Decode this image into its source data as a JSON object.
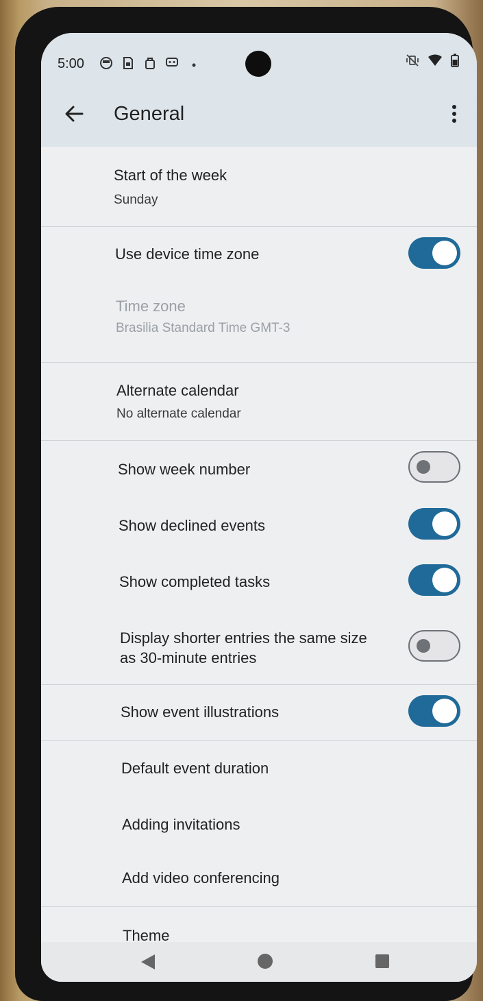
{
  "status_bar": {
    "time": "5:00",
    "left_icons": [
      "notification-icon",
      "sim-icon",
      "bag-icon",
      "message-icon"
    ],
    "dot": "•"
  },
  "app_bar": {
    "title": "General"
  },
  "settings": {
    "start_of_week": {
      "title": "Start of the week",
      "value": "Sunday"
    },
    "use_device_time_zone": {
      "title": "Use device time zone",
      "enabled": true
    },
    "time_zone": {
      "title": "Time zone",
      "value": "Brasilia Standard Time  GMT-3"
    },
    "alternate_calendar": {
      "title": "Alternate calendar",
      "value": "No alternate calendar"
    },
    "show_week_number": {
      "title": "Show week number",
      "enabled": false
    },
    "show_declined_events": {
      "title": "Show declined events",
      "enabled": true
    },
    "show_completed_tasks": {
      "title": "Show completed tasks",
      "enabled": true
    },
    "display_shorter_entries": {
      "title_line1": "Display shorter entries the same size",
      "title_line2": "as 30-minute entries",
      "enabled": false
    },
    "show_event_illustrations": {
      "title": "Show event illustrations",
      "enabled": true
    },
    "default_event_duration": {
      "title": "Default event duration"
    },
    "adding_invitations": {
      "title": "Adding invitations"
    },
    "add_video_conferencing": {
      "title": "Add video conferencing"
    },
    "theme": {
      "title": "Theme"
    }
  },
  "colors": {
    "toggle_on": "#1f6a98",
    "app_bar": "#dde4ea",
    "background": "#eeeff1"
  }
}
